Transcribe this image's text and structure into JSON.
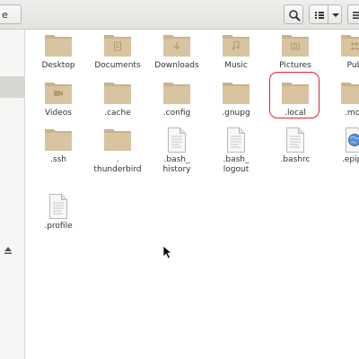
{
  "header": {
    "path_tail": "e",
    "buttons": [
      {
        "name": "search-button",
        "icon": "search-icon"
      },
      {
        "name": "view-toggle-button",
        "icon": "list-view-icon"
      },
      {
        "name": "view-options-dropdown",
        "icon": "chevron-down-icon"
      },
      {
        "name": "menu-button",
        "icon": "hamburger-menu-icon"
      }
    ]
  },
  "sidebar": {
    "eject_icon": "eject-icon"
  },
  "files": [
    {
      "label": "Desktop",
      "type": "folder",
      "icon": "folder-icon"
    },
    {
      "label": "Documents",
      "type": "folder-doc",
      "icon": "documents-folder-icon"
    },
    {
      "label": "Downloads",
      "type": "folder-download",
      "icon": "downloads-folder-icon"
    },
    {
      "label": "Music",
      "type": "folder-music",
      "icon": "music-folder-icon"
    },
    {
      "label": "Pictures",
      "type": "folder-camera",
      "icon": "pictures-folder-icon"
    },
    {
      "label": "Pub",
      "type": "folder-public",
      "icon": "public-folder-icon"
    },
    {
      "label": "Videos",
      "type": "folder-video",
      "icon": "videos-folder-icon"
    },
    {
      "label": ".cache",
      "type": "folder",
      "icon": "folder-icon"
    },
    {
      "label": ".config",
      "type": "folder",
      "icon": "folder-icon"
    },
    {
      "label": ".gnupg",
      "type": "folder",
      "icon": "folder-icon"
    },
    {
      "label": ".local",
      "type": "folder",
      "icon": "folder-icon"
    },
    {
      "label": ".moz",
      "type": "folder",
      "icon": "folder-icon"
    },
    {
      "label": ".ssh",
      "type": "folder",
      "icon": "folder-icon"
    },
    {
      "label": ".\nthunderbird",
      "type": "folder",
      "icon": "folder-icon"
    },
    {
      "label": ".bash_\nhistory",
      "type": "file",
      "icon": "text-file-icon"
    },
    {
      "label": ".bash_\nlogout",
      "type": "file",
      "icon": "text-file-icon"
    },
    {
      "label": ".bashrc",
      "type": "file",
      "icon": "text-file-icon"
    },
    {
      "label": ".epiph",
      "type": "globe",
      "icon": "web-file-icon"
    },
    {
      "label": ".profile",
      "type": "file",
      "icon": "text-file-icon"
    }
  ],
  "highlighted_item": ".local",
  "colors": {
    "folder_body": "#d8c4a0",
    "folder_tab": "#c8b38d",
    "highlight": "#e0242f"
  }
}
